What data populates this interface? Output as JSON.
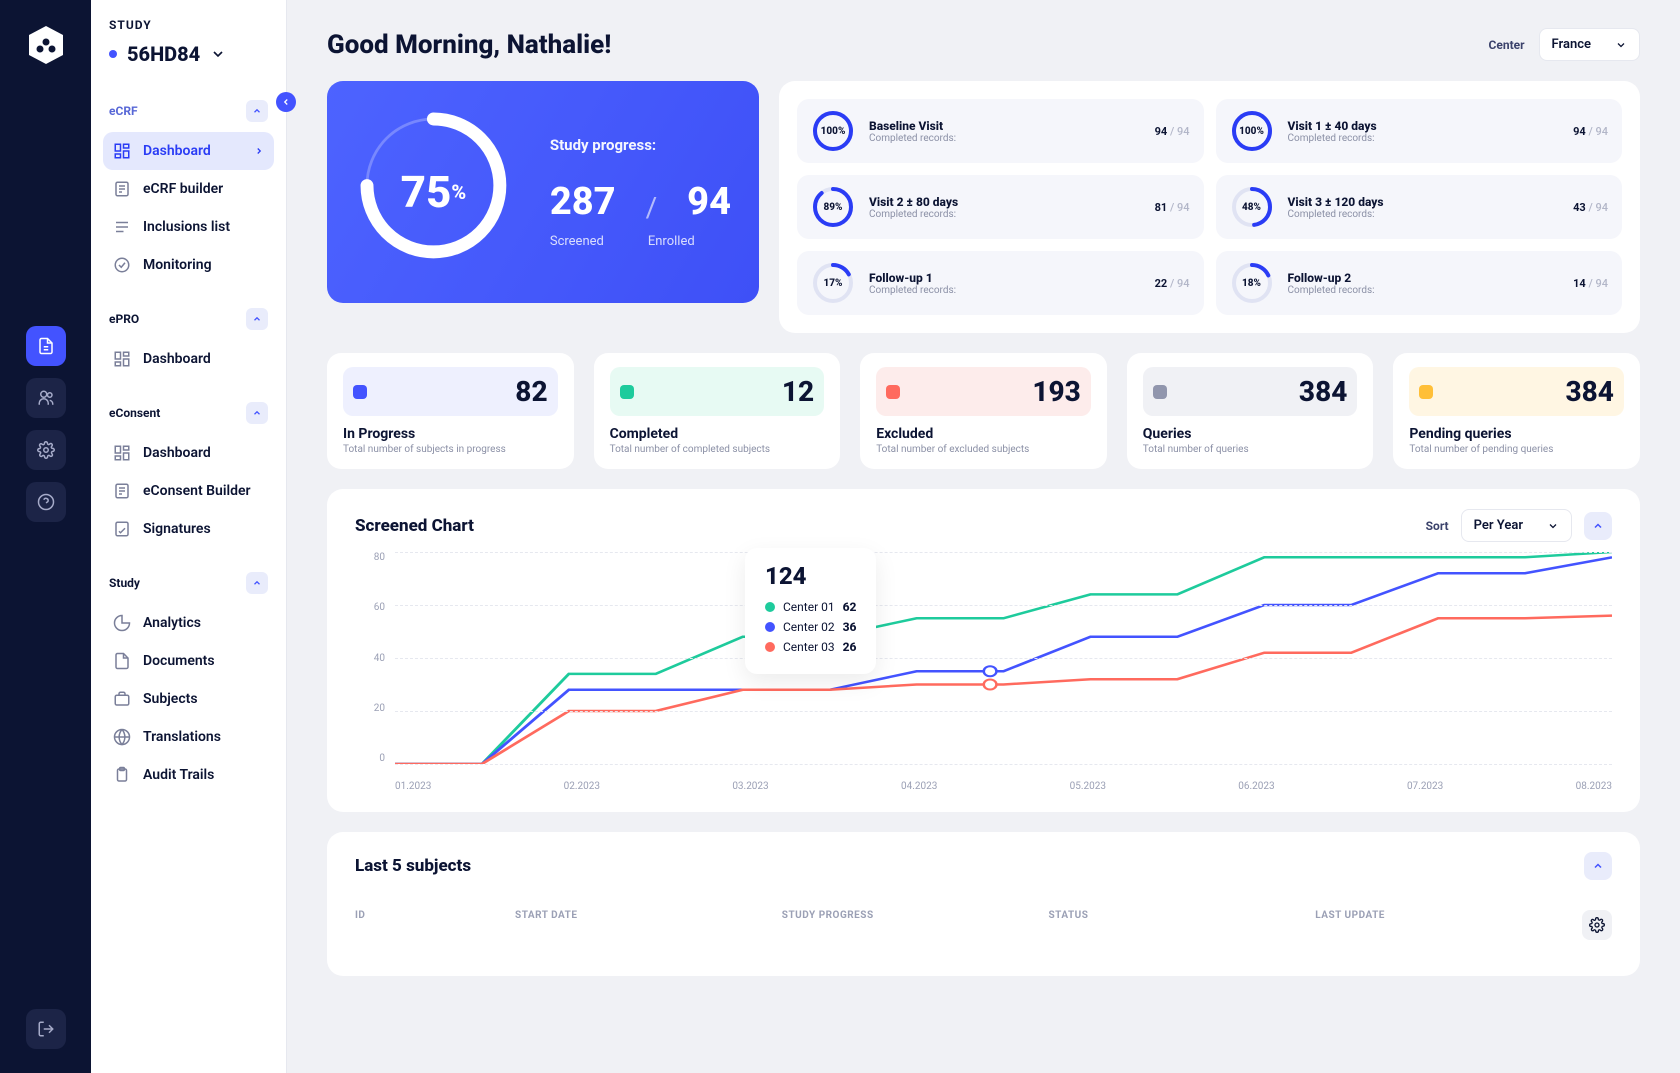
{
  "study": {
    "label": "STUDY",
    "code": "56HD84"
  },
  "nav": {
    "ecrf": {
      "label": "eCRF",
      "items": [
        {
          "label": "Dashboard",
          "icon": "dashboard-icon",
          "active": true,
          "arrow": true
        },
        {
          "label": "eCRF builder",
          "icon": "builder-icon"
        },
        {
          "label": "Inclusions list",
          "icon": "list-icon"
        },
        {
          "label": "Monitoring",
          "icon": "monitor-icon"
        }
      ]
    },
    "epro": {
      "label": "ePRO",
      "items": [
        {
          "label": "Dashboard",
          "icon": "dashboard-icon"
        }
      ]
    },
    "econsent": {
      "label": "eConsent",
      "items": [
        {
          "label": "Dashboard",
          "icon": "dashboard-icon"
        },
        {
          "label": "eConsent Builder",
          "icon": "builder-icon"
        },
        {
          "label": "Signatures",
          "icon": "signature-icon"
        }
      ]
    },
    "studymenu": {
      "label": "Study",
      "items": [
        {
          "label": "Analytics",
          "icon": "analytics-icon"
        },
        {
          "label": "Documents",
          "icon": "documents-icon"
        },
        {
          "label": "Subjects",
          "icon": "subjects-icon"
        },
        {
          "label": "Translations",
          "icon": "globe-icon"
        },
        {
          "label": "Audit Trails",
          "icon": "clipboard-icon"
        }
      ]
    }
  },
  "greeting": "Good Morning, Nathalie!",
  "center_label": "Center",
  "center_value": "France",
  "progress": {
    "title": "Study progress:",
    "percent": 75,
    "screened": 287,
    "screened_label": "Screened",
    "enrolled": 94,
    "enrolled_label": "Enrolled"
  },
  "visits": [
    {
      "title": "Baseline Visit",
      "sub": "Completed records:",
      "pct": "100%",
      "val": 94,
      "of": 94,
      "color": "#2a3cf5"
    },
    {
      "title": "Visit 1 ± 40 days",
      "sub": "Completed records:",
      "pct": "100%",
      "val": 94,
      "of": 94,
      "color": "#2a3cf5"
    },
    {
      "title": "Visit 2 ± 80 days",
      "sub": "Completed records:",
      "pct": "89%",
      "val": 81,
      "of": 94,
      "color": "#2a3cf5"
    },
    {
      "title": "Visit 3 ± 120 days",
      "sub": "Completed records:",
      "pct": "48%",
      "val": 43,
      "of": 94,
      "color": "#2a3cf5"
    },
    {
      "title": "Follow-up 1",
      "sub": "Completed records:",
      "pct": "17%",
      "val": 22,
      "of": 94,
      "color": "#2a3cf5"
    },
    {
      "title": "Follow-up 2",
      "sub": "Completed records:",
      "pct": "18%",
      "val": 14,
      "of": 94,
      "color": "#2a3cf5"
    }
  ],
  "kpis": [
    {
      "value": 82,
      "name": "In Progress",
      "desc": "Total number of subjects in progress",
      "color": "#4353ff",
      "bg": "#eef0fe"
    },
    {
      "value": 12,
      "name": "Completed",
      "desc": "Total number of completed subjects",
      "color": "#1ecb9c",
      "bg": "#e7faf3"
    },
    {
      "value": 193,
      "name": "Excluded",
      "desc": "Total number of excluded subjects",
      "color": "#ff6a5e",
      "bg": "#fdeceb"
    },
    {
      "value": 384,
      "name": "Queries",
      "desc": "Total number of queries",
      "color": "#9196ad",
      "bg": "#f0f1f5"
    },
    {
      "value": 384,
      "name": "Pending queries",
      "desc": "Total number of pending queries",
      "color": "#ffbf38",
      "bg": "#fff6e3"
    }
  ],
  "chart": {
    "title": "Screened Chart",
    "sort_label": "Sort",
    "sort_value": "Per Year",
    "legend_total": 124,
    "legend": [
      {
        "name": "Center 01",
        "val": 62,
        "color": "#1ecb9c"
      },
      {
        "name": "Center 02",
        "val": 36,
        "color": "#4353ff"
      },
      {
        "name": "Center 03",
        "val": 26,
        "color": "#ff6a5e"
      }
    ],
    "y_ticks": [
      "80",
      "60",
      "40",
      "20",
      "0"
    ],
    "x_ticks": [
      "01.2023",
      "02.2023",
      "03.2023",
      "04.2023",
      "05.2023",
      "06.2023",
      "07.2023",
      "08.2023"
    ]
  },
  "chart_data": {
    "type": "line",
    "title": "Screened Chart",
    "xlabel": "",
    "ylabel": "",
    "ylim": [
      0,
      80
    ],
    "categories": [
      "01.2023",
      "02.2023",
      "03.2023",
      "04.2023",
      "05.2023",
      "06.2023",
      "07.2023",
      "08.2023"
    ],
    "series": [
      {
        "name": "Center 01",
        "color": "#1ecb9c",
        "values": [
          0,
          34,
          48,
          55,
          64,
          78,
          78,
          80
        ]
      },
      {
        "name": "Center 02",
        "color": "#4353ff",
        "values": [
          0,
          28,
          28,
          35,
          48,
          60,
          72,
          78
        ]
      },
      {
        "name": "Center 03",
        "color": "#ff6a5e",
        "values": [
          0,
          20,
          28,
          30,
          32,
          42,
          55,
          56
        ]
      }
    ]
  },
  "subjects": {
    "title": "Last 5 subjects",
    "columns": [
      "ID",
      "START DATE",
      "STUDY PROGRESS",
      "STATUS",
      "LAST UPDATE"
    ]
  }
}
